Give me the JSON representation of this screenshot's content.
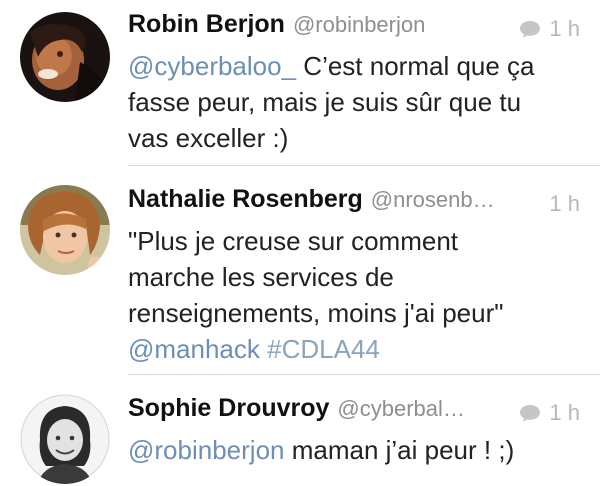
{
  "tweets": [
    {
      "name": "Robin Berjon",
      "handle": "@robinberjon",
      "time": "1 h",
      "show_reply_icon": true,
      "segments": [
        {
          "type": "mention",
          "text": "@cyberbaloo_"
        },
        {
          "type": "text",
          "text": " C’est normal que ça"
        },
        {
          "type": "break"
        },
        {
          "type": "text",
          "text": "fasse peur, mais je suis sûr que tu"
        },
        {
          "type": "break"
        },
        {
          "type": "text",
          "text": "vas exceller :)"
        }
      ]
    },
    {
      "name": "Nathalie Rosenberg",
      "handle": "@nrosenb…",
      "time": "1 h",
      "show_reply_icon": false,
      "segments": [
        {
          "type": "text",
          "text": "\"Plus je creuse sur comment"
        },
        {
          "type": "break"
        },
        {
          "type": "text",
          "text": "marche les services de"
        },
        {
          "type": "break"
        },
        {
          "type": "text",
          "text": "renseignements, moins j'ai peur\""
        },
        {
          "type": "break"
        },
        {
          "type": "mention",
          "text": "@manhack"
        },
        {
          "type": "text",
          "text": " "
        },
        {
          "type": "hashtag",
          "text": "#CDLA44"
        }
      ]
    },
    {
      "name": "Sophie Drouvroy",
      "handle": "@cyberbal…",
      "time": "1 h",
      "show_reply_icon": true,
      "segments": [
        {
          "type": "mention",
          "text": "@robinberjon"
        },
        {
          "type": "text",
          "text": " maman j’ai peur ! ;)"
        }
      ]
    }
  ],
  "colors": {
    "mention": "#6d8fb5",
    "hashtag": "#8aa3bf",
    "meta": "#b7b7bc",
    "separator": "#d9d9dd"
  }
}
